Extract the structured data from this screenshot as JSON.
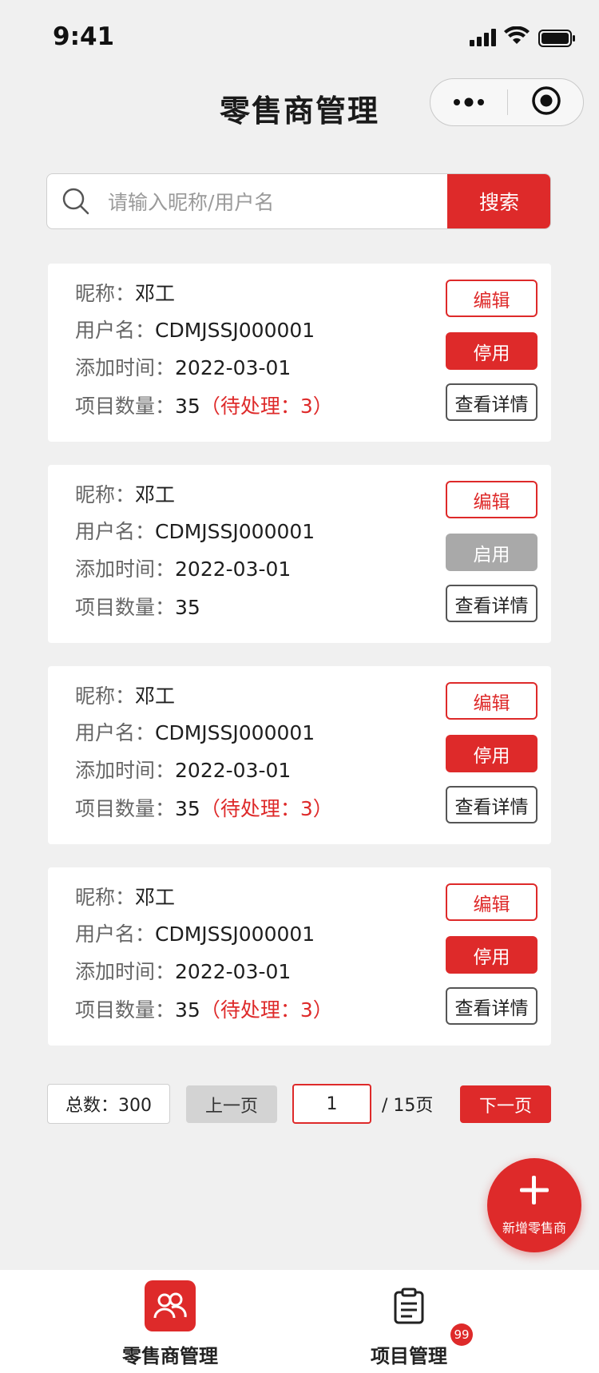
{
  "status_bar": {
    "time": "9:41"
  },
  "nav": {
    "title": "零售商管理"
  },
  "search": {
    "placeholder": "请输入昵称/用户名",
    "button_label": "搜索"
  },
  "labels": {
    "nickname": "昵称：",
    "username": "用户名：",
    "added_time": "添加时间：",
    "project_count": "项目数量："
  },
  "cards": [
    {
      "nickname": "邓工",
      "username": "CDMJSSJ000001",
      "added_time": "2022-03-01",
      "project_count": "35",
      "pending": "（待处理：3）",
      "edit_label": "编辑",
      "toggle_label": "停用",
      "toggle_state": "active",
      "detail_label": "查看详情"
    },
    {
      "nickname": "邓工",
      "username": "CDMJSSJ000001",
      "added_time": "2022-03-01",
      "project_count": "35",
      "pending": "",
      "edit_label": "编辑",
      "toggle_label": "启用",
      "toggle_state": "disabled",
      "detail_label": "查看详情"
    },
    {
      "nickname": "邓工",
      "username": "CDMJSSJ000001",
      "added_time": "2022-03-01",
      "project_count": "35",
      "pending": "（待处理：3）",
      "edit_label": "编辑",
      "toggle_label": "停用",
      "toggle_state": "active",
      "detail_label": "查看详情"
    },
    {
      "nickname": "邓工",
      "username": "CDMJSSJ000001",
      "added_time": "2022-03-01",
      "project_count": "35",
      "pending": "（待处理：3）",
      "edit_label": "编辑",
      "toggle_label": "停用",
      "toggle_state": "active",
      "detail_label": "查看详情"
    }
  ],
  "pagination": {
    "total": "总数：300",
    "prev_label": "上一页",
    "current_page": "1",
    "total_pages": "/ 15页",
    "next_label": "下一页"
  },
  "fab": {
    "label": "新增零售商",
    "icon": "plus-icon"
  },
  "tabbar": {
    "tabs": [
      {
        "label": "零售商管理",
        "icon": "users-icon",
        "active": true
      },
      {
        "label": "项目管理",
        "icon": "clipboard-icon",
        "active": false,
        "badge": "99"
      }
    ]
  },
  "colors": {
    "accent": "#de2a2a",
    "disabled": "#a9a9a9",
    "background": "#f0f0f0"
  }
}
